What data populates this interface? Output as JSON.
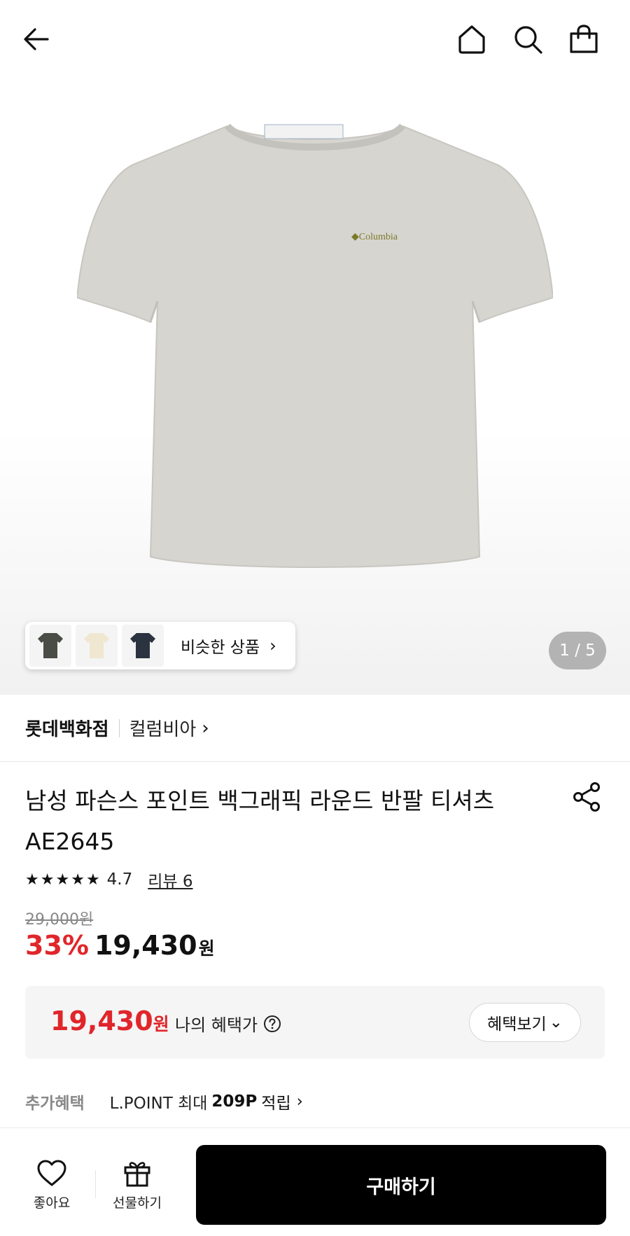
{
  "header": {
    "icons": [
      "back-arrow-icon",
      "home-icon",
      "search-icon",
      "shopping-bag-icon"
    ]
  },
  "gallery": {
    "product_logo": "Columbia",
    "similar_label": "비슷한 상품",
    "similar_chevron": "›",
    "counter": "1 / 5",
    "thumbnail_colors": [
      "#4a4d45",
      "#efe7cf",
      "#2b3340"
    ],
    "shirt_color": "#d7d5d0"
  },
  "brand": {
    "main": "롯데백화점",
    "sub": "컬럼비아",
    "chevron": "›"
  },
  "product": {
    "title": "남성 파슨스 포인트 백그래픽 라운드 반팔 티셔츠 AE2645",
    "rating_value": "4.7",
    "rating_stars": 4.7,
    "reviews": "리뷰 6"
  },
  "price": {
    "original": "29,000원",
    "discount": "33%",
    "sale": "19,430",
    "won": "원"
  },
  "benefit": {
    "price": "19,430",
    "won": "원",
    "label": "나의 혜택가",
    "button": "혜택보기",
    "button_chevron": "⌄"
  },
  "extra": {
    "label": "추가혜택",
    "text_prefix": "L.POINT 최대",
    "text_bold": "209P",
    "text_suffix": "적립",
    "chevron": "›"
  },
  "bottom_bar": {
    "like_label": "좋아요",
    "gift_label": "선물하기",
    "buy_label": "구매하기"
  },
  "colors": {
    "accent_red": "#e0262b",
    "buy_button": "#000000"
  }
}
